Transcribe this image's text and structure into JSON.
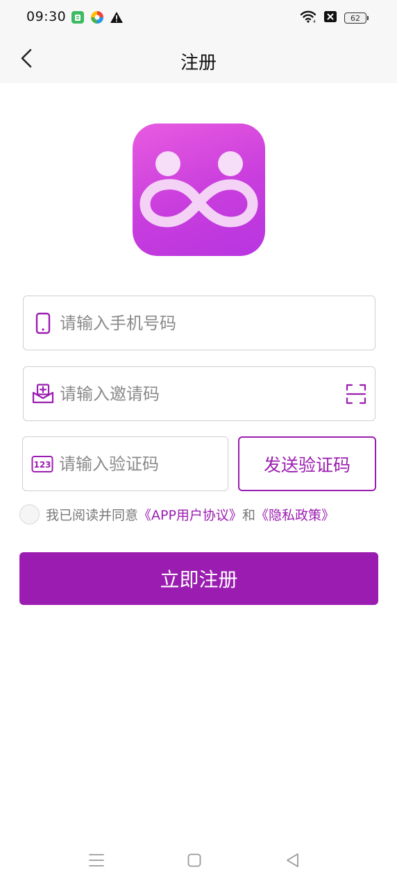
{
  "status_bar": {
    "time": "09:30",
    "battery": "62",
    "left_icons": [
      "app-notification-icon",
      "color-app-icon",
      "warning-icon"
    ],
    "right_icons": [
      "wifi-icon",
      "no-sim-icon",
      "battery-icon"
    ]
  },
  "nav": {
    "title": "注册",
    "back_icon": "chevron-left-icon"
  },
  "form": {
    "phone_placeholder": "请输入手机号码",
    "invite_placeholder": "请输入邀请码",
    "code_placeholder": "请输入验证码",
    "send_code_label": "发送验证码"
  },
  "agreement": {
    "prefix": "我已阅读并同意",
    "app_agreement_link": "《APP用户协议》",
    "and": "和",
    "privacy_link": "《隐私政策》"
  },
  "register_label": "立即注册",
  "colors": {
    "accent": "#9b1cb0",
    "logo_gradient_start": "#e85be0",
    "logo_gradient_end": "#b835e0",
    "border": "#cfcfcf",
    "placeholder": "#8a8a8a"
  }
}
